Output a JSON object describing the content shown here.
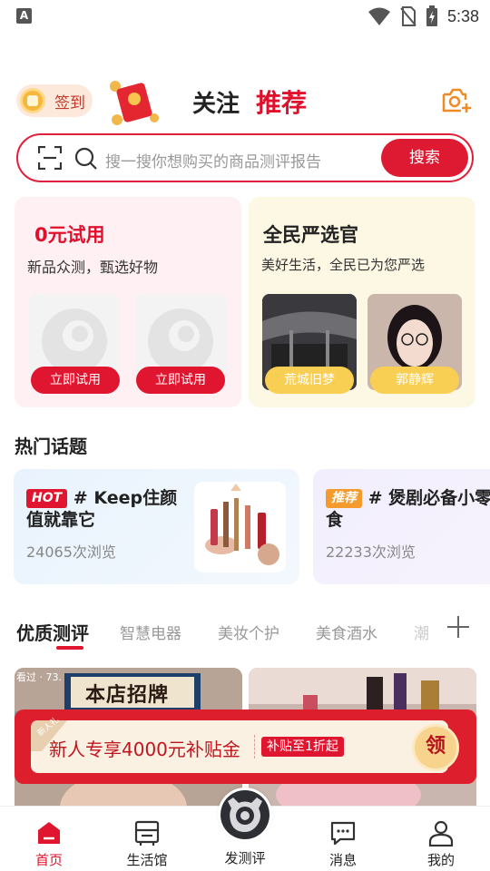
{
  "status_bar": {
    "time": "5:38",
    "app_icon_letter": "A"
  },
  "header": {
    "signin_label": "签到",
    "tabs": [
      {
        "label": "关注",
        "active": false
      },
      {
        "label": "推荐",
        "active": true
      }
    ]
  },
  "search": {
    "placeholder": "搜一搜你想购买的商品测评报告",
    "button_label": "搜索"
  },
  "trial_card": {
    "title": "0元试用",
    "subtitle": "新品众测，甄选好物",
    "buttons": [
      "立即试用",
      "立即试用"
    ]
  },
  "select_card": {
    "title": "全民严选官",
    "subtitle": "美好生活，全民已为您严选",
    "people": [
      "荒城旧梦",
      "郭静辉"
    ]
  },
  "hot_topics": {
    "title": "热门话题",
    "items": [
      {
        "tag": "HOT",
        "hash": "#",
        "title": "Keep住颜值就靠它",
        "views": "24065次浏览"
      },
      {
        "tag": "推荐",
        "hash": "#",
        "title": "煲剧必备小零食",
        "views": "22233次浏览"
      }
    ]
  },
  "categories": {
    "items": [
      "优质测评",
      "智慧电器",
      "美妆个护",
      "美食酒水",
      "潮"
    ],
    "active_index": 0
  },
  "feed": {
    "item1_overlay": "看过 · 73.",
    "item1_sign": "本店招牌"
  },
  "promo": {
    "corner_tag": "新人礼",
    "text": "新人专享4000元补贴金",
    "badge": "补贴至1折起",
    "claim_label": "领"
  },
  "bottom_nav": {
    "items": [
      {
        "label": "首页",
        "active": true
      },
      {
        "label": "生活馆",
        "active": false
      },
      {
        "label": "发测评",
        "active": false
      },
      {
        "label": "消息",
        "active": false
      },
      {
        "label": "我的",
        "active": false
      }
    ]
  },
  "colors": {
    "brand_red": "#e0152f",
    "trial_bg": "#fff1f3",
    "select_bg": "#fdf8e3",
    "pill_yellow": "#f9cf53",
    "accent_orange": "#f59a2c"
  }
}
